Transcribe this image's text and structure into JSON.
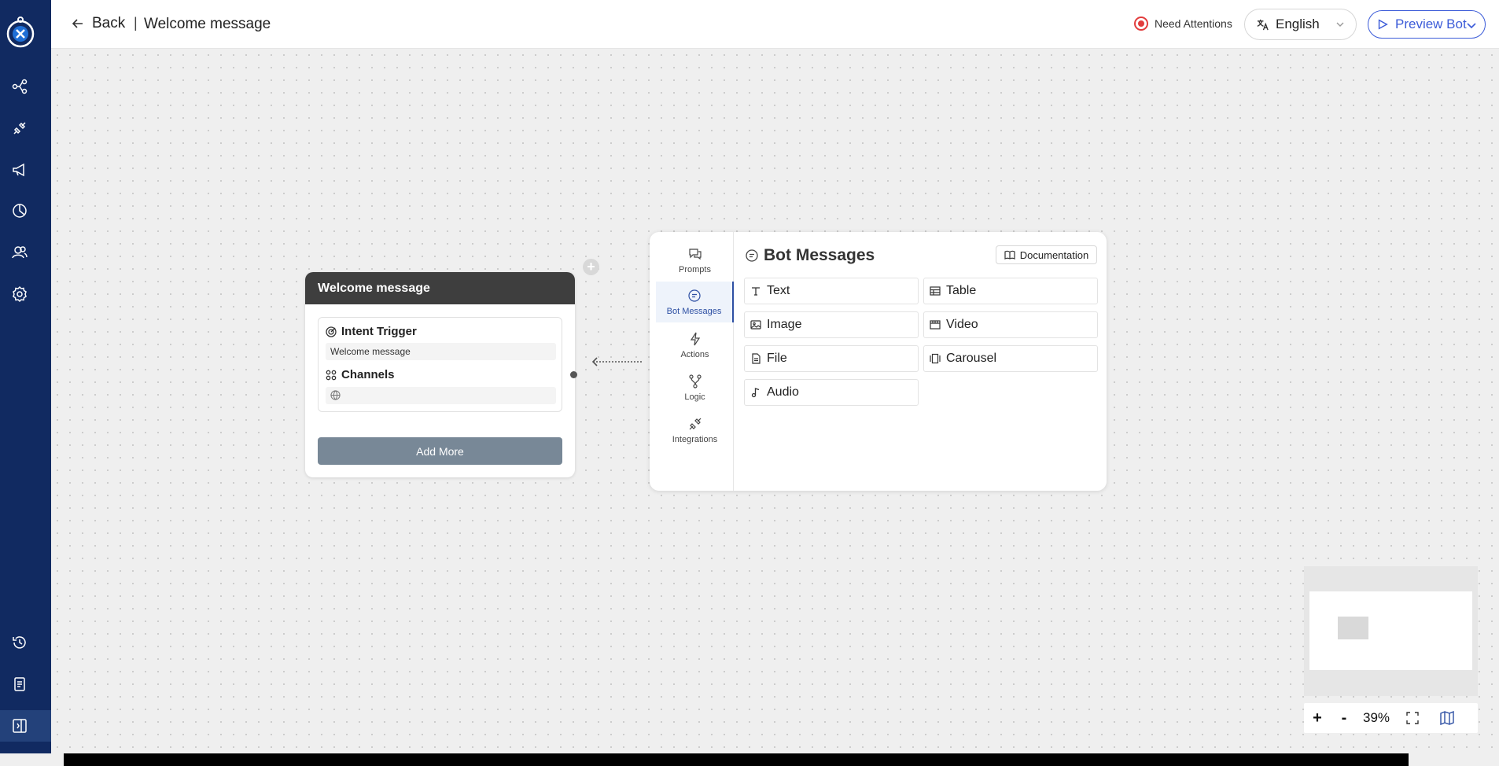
{
  "sidebar": {
    "logo": "bot-logo",
    "items": [
      {
        "name": "flow-icon"
      },
      {
        "name": "integrations-icon"
      },
      {
        "name": "broadcast-icon"
      },
      {
        "name": "analytics-icon"
      },
      {
        "name": "users-icon"
      },
      {
        "name": "settings-icon"
      },
      {
        "name": "history-icon"
      },
      {
        "name": "docs-icon"
      },
      {
        "name": "collapse-sidebar-icon"
      }
    ]
  },
  "header": {
    "back_label": "Back",
    "separator": "|",
    "title": "Welcome message",
    "attention_label": "Need Attentions",
    "language": "English",
    "preview_label": "Preview Bot"
  },
  "node": {
    "title": "Welcome message",
    "intent_label": "Intent Trigger",
    "intent_value": "Welcome message",
    "channels_label": "Channels",
    "add_more_label": "Add More"
  },
  "panel": {
    "nav": [
      {
        "label": "Prompts",
        "icon": "chat-bubbles-icon"
      },
      {
        "label": "Bot Messages",
        "icon": "message-icon",
        "active": true
      },
      {
        "label": "Actions",
        "icon": "lightning-icon"
      },
      {
        "label": "Logic",
        "icon": "branch-icon"
      },
      {
        "label": "Integrations",
        "icon": "plug-icon"
      }
    ],
    "title": "Bot Messages",
    "documentation_label": "Documentation",
    "options": [
      {
        "label": "Text",
        "icon": "text-icon"
      },
      {
        "label": "Table",
        "icon": "table-icon"
      },
      {
        "label": "Image",
        "icon": "image-icon"
      },
      {
        "label": "Video",
        "icon": "video-icon"
      },
      {
        "label": "File",
        "icon": "file-icon"
      },
      {
        "label": "Carousel",
        "icon": "carousel-icon"
      },
      {
        "label": "Audio",
        "icon": "audio-icon"
      }
    ]
  },
  "zoom": {
    "plus": "+",
    "minus": "-",
    "level": "39%"
  },
  "colors": {
    "sidebar": "#112a61",
    "accent": "#3b5bd8",
    "attention": "#e23c3c",
    "node_header": "#3e3e3e",
    "add_more": "#788897"
  }
}
